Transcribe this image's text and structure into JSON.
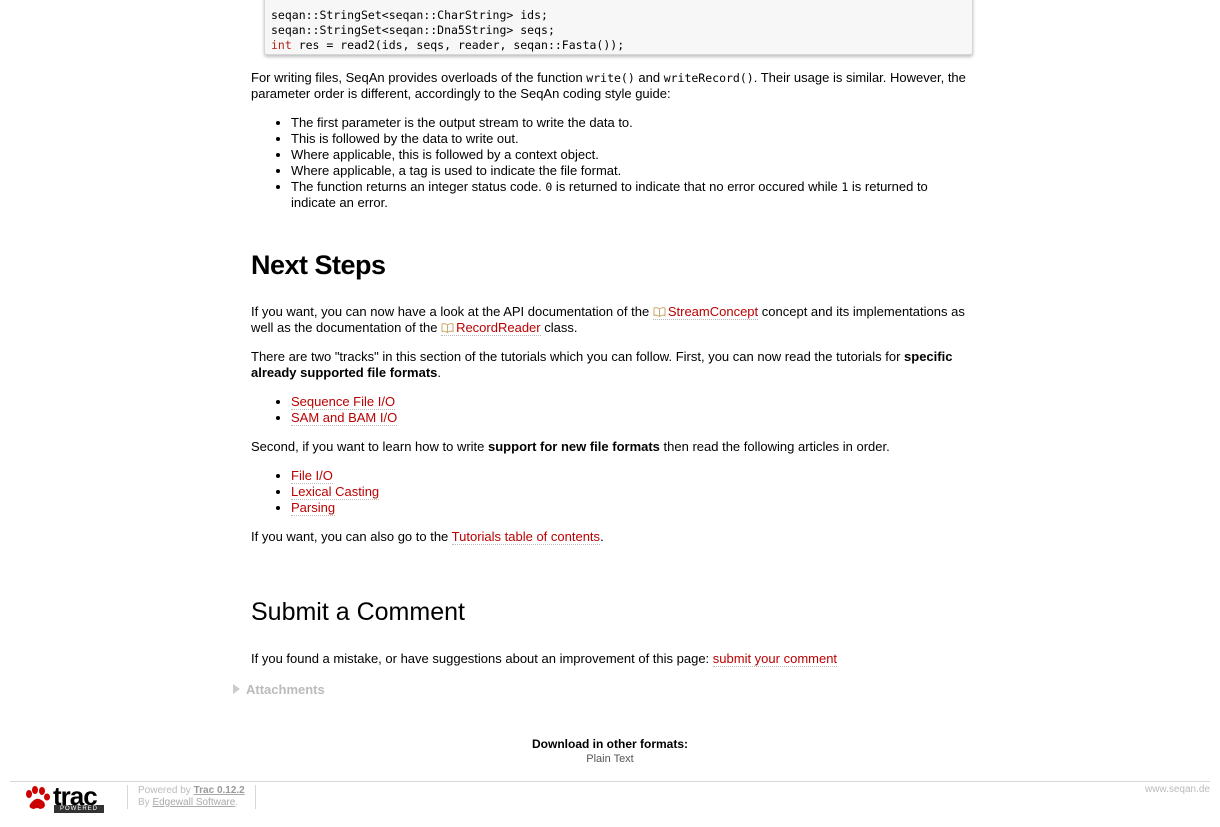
{
  "code": {
    "line1": "seqan::StringSet<seqan::CharString> ids;",
    "line2": "seqan::StringSet<seqan::Dna5String> seqs;",
    "line3_kw": "int",
    "line3_rest": " res = read2(ids, seqs, reader, seqan::Fasta());"
  },
  "writing": {
    "p1_a": "For writing files, SeqAn provides overloads of the function ",
    "fn_write": "write()",
    "p1_b": " and ",
    "fn_writeRecord": "writeRecord()",
    "p1_c": ". Their usage is similar. However, the parameter order is different, accordingly to the SeqAn coding style guide:",
    "bullets": [
      "The first parameter is the output stream to write the data to.",
      "This is followed by the data to write out.",
      "Where applicable, this is followed by a context object.",
      "Where applicable, a tag is used to indicate the file format."
    ],
    "last_a": "The function returns an integer status code. ",
    "last_zero": "0",
    "last_b": " is returned to indicate that no error occured while ",
    "last_one": "1",
    "last_c": " is returned to indicate an error."
  },
  "next_steps": {
    "heading": "Next Steps",
    "p1_a": "If you want, you can now have a look at the API documentation of the ",
    "link_stream": "StreamConcept",
    "p1_b": " concept and its implementations as well as the documentation of the ",
    "link_reader": "RecordReader",
    "p1_c": " class.",
    "p2_a": "There are two \"tracks\" in this section of the tutorials which you can follow. First, you can now read the tutorials for ",
    "p2_bold": "specific already supported file formats",
    "p2_c": ".",
    "list1": [
      "Sequence File I/O",
      "SAM and BAM I/O"
    ],
    "p3_a": "Second, if you want to learn how to write ",
    "p3_bold": "support for new file formats",
    "p3_c": " then read the following articles in order.",
    "list2": [
      "File I/O",
      "Lexical Casting",
      "Parsing"
    ],
    "p4_a": "If you want, you can also go to the ",
    "p4_link": "Tutorials table of contents",
    "p4_c": "."
  },
  "comment": {
    "heading": "Submit a Comment",
    "text": "If you found a mistake, or have suggestions about an improvement of this page: ",
    "link": "submit your comment"
  },
  "attachments": {
    "label": "Attachments"
  },
  "download": {
    "title": "Download in other formats:",
    "item": "Plain Text"
  },
  "footer": {
    "logo_text": "trac",
    "logo_sub": "POWERED",
    "powered_by": "Powered by ",
    "trac_version": "Trac 0.12.2",
    "by": "By ",
    "edgewall": "Edgewall Software",
    "period": ".",
    "site": "www.seqan.de"
  },
  "colors": {
    "link": "#bb0000",
    "keyword": "#b4261a",
    "muted": "#bbbbbb"
  }
}
